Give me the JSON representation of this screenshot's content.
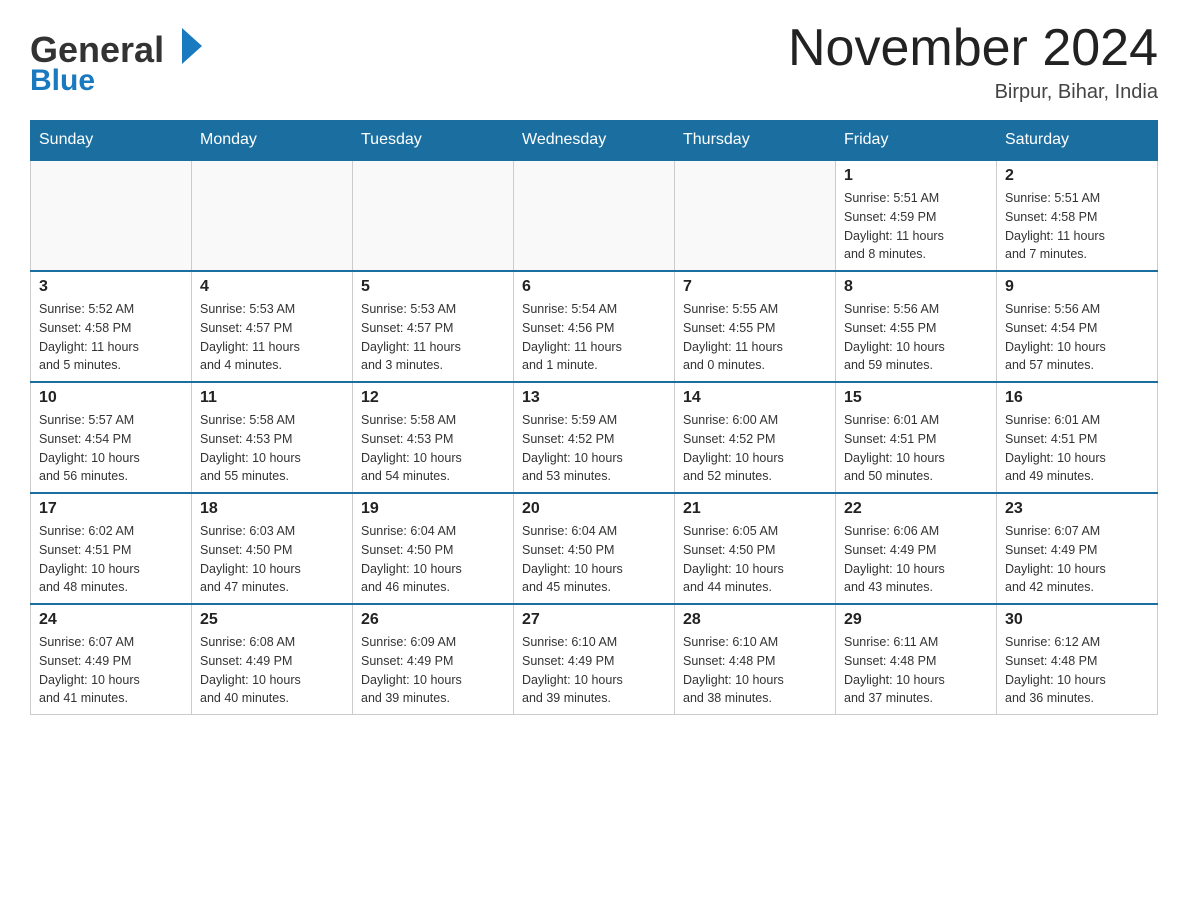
{
  "header": {
    "logo_general": "General",
    "logo_blue": "Blue",
    "month_title": "November 2024",
    "location": "Birpur, Bihar, India"
  },
  "weekdays": [
    "Sunday",
    "Monday",
    "Tuesday",
    "Wednesday",
    "Thursday",
    "Friday",
    "Saturday"
  ],
  "weeks": [
    {
      "days": [
        {
          "num": "",
          "info": ""
        },
        {
          "num": "",
          "info": ""
        },
        {
          "num": "",
          "info": ""
        },
        {
          "num": "",
          "info": ""
        },
        {
          "num": "",
          "info": ""
        },
        {
          "num": "1",
          "info": "Sunrise: 5:51 AM\nSunset: 4:59 PM\nDaylight: 11 hours\nand 8 minutes."
        },
        {
          "num": "2",
          "info": "Sunrise: 5:51 AM\nSunset: 4:58 PM\nDaylight: 11 hours\nand 7 minutes."
        }
      ]
    },
    {
      "days": [
        {
          "num": "3",
          "info": "Sunrise: 5:52 AM\nSunset: 4:58 PM\nDaylight: 11 hours\nand 5 minutes."
        },
        {
          "num": "4",
          "info": "Sunrise: 5:53 AM\nSunset: 4:57 PM\nDaylight: 11 hours\nand 4 minutes."
        },
        {
          "num": "5",
          "info": "Sunrise: 5:53 AM\nSunset: 4:57 PM\nDaylight: 11 hours\nand 3 minutes."
        },
        {
          "num": "6",
          "info": "Sunrise: 5:54 AM\nSunset: 4:56 PM\nDaylight: 11 hours\nand 1 minute."
        },
        {
          "num": "7",
          "info": "Sunrise: 5:55 AM\nSunset: 4:55 PM\nDaylight: 11 hours\nand 0 minutes."
        },
        {
          "num": "8",
          "info": "Sunrise: 5:56 AM\nSunset: 4:55 PM\nDaylight: 10 hours\nand 59 minutes."
        },
        {
          "num": "9",
          "info": "Sunrise: 5:56 AM\nSunset: 4:54 PM\nDaylight: 10 hours\nand 57 minutes."
        }
      ]
    },
    {
      "days": [
        {
          "num": "10",
          "info": "Sunrise: 5:57 AM\nSunset: 4:54 PM\nDaylight: 10 hours\nand 56 minutes."
        },
        {
          "num": "11",
          "info": "Sunrise: 5:58 AM\nSunset: 4:53 PM\nDaylight: 10 hours\nand 55 minutes."
        },
        {
          "num": "12",
          "info": "Sunrise: 5:58 AM\nSunset: 4:53 PM\nDaylight: 10 hours\nand 54 minutes."
        },
        {
          "num": "13",
          "info": "Sunrise: 5:59 AM\nSunset: 4:52 PM\nDaylight: 10 hours\nand 53 minutes."
        },
        {
          "num": "14",
          "info": "Sunrise: 6:00 AM\nSunset: 4:52 PM\nDaylight: 10 hours\nand 52 minutes."
        },
        {
          "num": "15",
          "info": "Sunrise: 6:01 AM\nSunset: 4:51 PM\nDaylight: 10 hours\nand 50 minutes."
        },
        {
          "num": "16",
          "info": "Sunrise: 6:01 AM\nSunset: 4:51 PM\nDaylight: 10 hours\nand 49 minutes."
        }
      ]
    },
    {
      "days": [
        {
          "num": "17",
          "info": "Sunrise: 6:02 AM\nSunset: 4:51 PM\nDaylight: 10 hours\nand 48 minutes."
        },
        {
          "num": "18",
          "info": "Sunrise: 6:03 AM\nSunset: 4:50 PM\nDaylight: 10 hours\nand 47 minutes."
        },
        {
          "num": "19",
          "info": "Sunrise: 6:04 AM\nSunset: 4:50 PM\nDaylight: 10 hours\nand 46 minutes."
        },
        {
          "num": "20",
          "info": "Sunrise: 6:04 AM\nSunset: 4:50 PM\nDaylight: 10 hours\nand 45 minutes."
        },
        {
          "num": "21",
          "info": "Sunrise: 6:05 AM\nSunset: 4:50 PM\nDaylight: 10 hours\nand 44 minutes."
        },
        {
          "num": "22",
          "info": "Sunrise: 6:06 AM\nSunset: 4:49 PM\nDaylight: 10 hours\nand 43 minutes."
        },
        {
          "num": "23",
          "info": "Sunrise: 6:07 AM\nSunset: 4:49 PM\nDaylight: 10 hours\nand 42 minutes."
        }
      ]
    },
    {
      "days": [
        {
          "num": "24",
          "info": "Sunrise: 6:07 AM\nSunset: 4:49 PM\nDaylight: 10 hours\nand 41 minutes."
        },
        {
          "num": "25",
          "info": "Sunrise: 6:08 AM\nSunset: 4:49 PM\nDaylight: 10 hours\nand 40 minutes."
        },
        {
          "num": "26",
          "info": "Sunrise: 6:09 AM\nSunset: 4:49 PM\nDaylight: 10 hours\nand 39 minutes."
        },
        {
          "num": "27",
          "info": "Sunrise: 6:10 AM\nSunset: 4:49 PM\nDaylight: 10 hours\nand 39 minutes."
        },
        {
          "num": "28",
          "info": "Sunrise: 6:10 AM\nSunset: 4:48 PM\nDaylight: 10 hours\nand 38 minutes."
        },
        {
          "num": "29",
          "info": "Sunrise: 6:11 AM\nSunset: 4:48 PM\nDaylight: 10 hours\nand 37 minutes."
        },
        {
          "num": "30",
          "info": "Sunrise: 6:12 AM\nSunset: 4:48 PM\nDaylight: 10 hours\nand 36 minutes."
        }
      ]
    }
  ]
}
